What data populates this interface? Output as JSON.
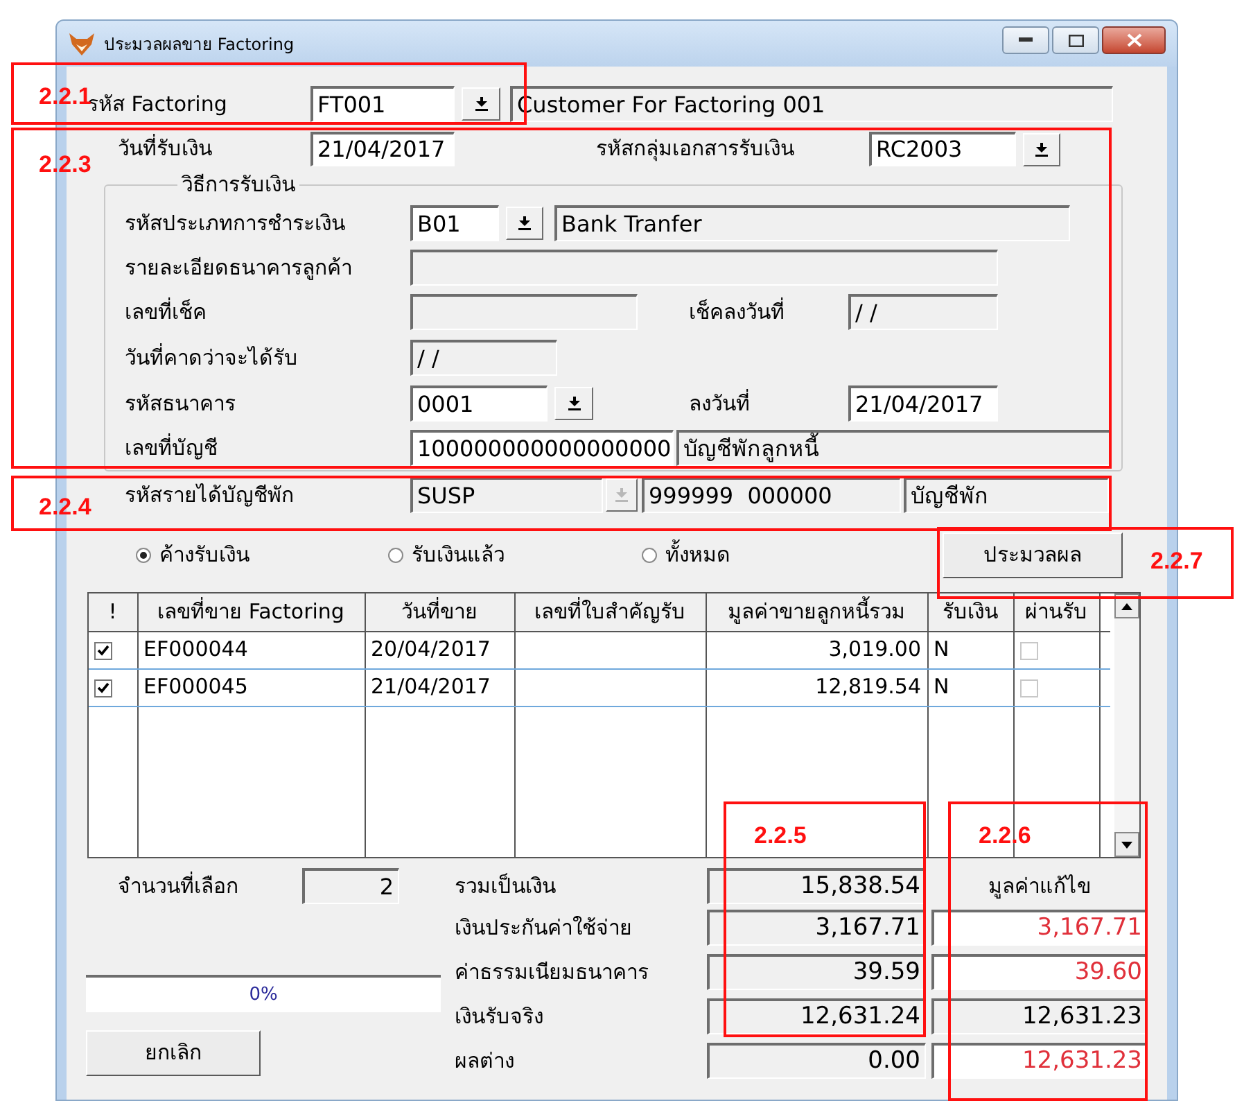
{
  "window": {
    "title": "ประมวลผลขาย Factoring"
  },
  "header_rows": [
    {
      "items": [
        {
          "kind": "label",
          "text": "รหัส Factoring"
        },
        {
          "kind": "field",
          "value": "FT001",
          "editable": true
        },
        {
          "kind": "dropdown",
          "disabled": false
        },
        {
          "kind": "field",
          "value": "Customer For Factoring 001",
          "editable": false
        }
      ]
    },
    {
      "items": [
        {
          "kind": "label",
          "text": "วันที่รับเงิน"
        },
        {
          "kind": "field",
          "value": "21/04/2017",
          "editable": true
        },
        {
          "kind": "label",
          "text": "รหัสกลุ่มเอกสารรับเงิน"
        },
        {
          "kind": "field",
          "value": "RC2003",
          "editable": true
        },
        {
          "kind": "dropdown",
          "disabled": false
        }
      ]
    }
  ],
  "payment_group": {
    "title": "วิธีการรับเงิน",
    "rows": [
      {
        "items": [
          {
            "kind": "label",
            "text": "รหัสประเภทการชำระเงิน"
          },
          {
            "kind": "field",
            "value": "B01",
            "editable": true
          },
          {
            "kind": "dropdown",
            "disabled": false
          },
          {
            "kind": "field",
            "value": "Bank Tranfer",
            "editable": false
          }
        ]
      },
      {
        "items": [
          {
            "kind": "label",
            "text": "รายละเอียดธนาคารลูกค้า"
          },
          {
            "kind": "field",
            "editable": false
          }
        ]
      },
      {
        "items": [
          {
            "kind": "label",
            "text": "เลขที่เช็ค"
          },
          {
            "kind": "field",
            "editable": false
          },
          {
            "kind": "label",
            "text": "เช็คลงวันที่"
          },
          {
            "kind": "field",
            "value": "/ /",
            "editable": false
          }
        ]
      },
      {
        "items": [
          {
            "kind": "label",
            "text": "วันที่คาดว่าจะได้รับ"
          },
          {
            "kind": "field",
            "value": "/ /",
            "editable": false
          }
        ]
      },
      {
        "items": [
          {
            "kind": "label",
            "text": "รหัสธนาคาร"
          },
          {
            "kind": "field",
            "value": "0001",
            "editable": true
          },
          {
            "kind": "dropdown",
            "disabled": false
          },
          {
            "kind": "label",
            "text": "ลงวันที่"
          },
          {
            "kind": "field",
            "value": "21/04/2017",
            "editable": true
          }
        ]
      },
      {
        "items": [
          {
            "kind": "label",
            "text": "เลขที่บัญชี"
          },
          {
            "kind": "field",
            "value": "100000000000000000",
            "editable": true
          },
          {
            "kind": "field",
            "value": "บัญชีพักลูกหนี้",
            "editable": false
          }
        ]
      }
    ]
  },
  "suspense_row": {
    "items": [
      {
        "kind": "label",
        "text": "รหัสรายได้บัญชีพัก"
      },
      {
        "kind": "field",
        "value": "SUSP",
        "editable": false
      },
      {
        "kind": "dropdown",
        "disabled": true
      },
      {
        "kind": "field",
        "value": "999999  000000",
        "editable": false
      },
      {
        "kind": "field",
        "value": "บัญชีพัก",
        "editable": false
      }
    ]
  },
  "filter": {
    "options": [
      {
        "label": "ค้างรับเงิน",
        "selected": true
      },
      {
        "label": "รับเงินแล้ว",
        "selected": false
      },
      {
        "label": "ทั้งหมด",
        "selected": false
      }
    ]
  },
  "process_button": "ประมวลผล",
  "table": {
    "columns": [
      "!",
      "เลขที่ขาย Factoring",
      "วันที่ขาย",
      "เลขที่ใบสำคัญรับ",
      "มูลค่าขายลูกหนี้รวม",
      "รับเงิน",
      "ผ่านรับ"
    ],
    "rows": [
      {
        "checked": true,
        "number": "EF000044",
        "date": "20/04/2017",
        "amount": "3,019.00",
        "received": "N",
        "passed": false
      },
      {
        "checked": true,
        "number": "EF000045",
        "date": "21/04/2017",
        "amount": "12,819.54",
        "received": "N",
        "passed": false
      }
    ]
  },
  "summary": {
    "selected_count": {
      "label": "จำนวนที่เลือก",
      "value": "2"
    },
    "revised_header": "มูลค่าแก้ไข",
    "rows": [
      {
        "label": "รวมเป็นเงิน",
        "value": "15,838.54"
      },
      {
        "label": "เงินประกันค่าใช้จ่าย",
        "value": "3,167.71",
        "revised": {
          "value": "3,167.71",
          "changed": true
        }
      },
      {
        "label": "ค่าธรรมเนียมธนาคาร",
        "value": "39.59",
        "revised": {
          "value": "39.60",
          "changed": true
        }
      },
      {
        "label": "เงินรับจริง",
        "value": "12,631.24",
        "revised": {
          "value": "12,631.23",
          "changed": false
        }
      },
      {
        "label": "ผลต่าง",
        "value": "0.00",
        "revised": {
          "value": "12,631.23",
          "changed": true
        }
      }
    ]
  },
  "progress": {
    "text": "0%",
    "level": 0
  },
  "cancel_button": "ยกเลิก",
  "annotations": [
    {
      "label": "2.2.1"
    },
    {
      "label": "2.2.3"
    },
    {
      "label": "2.2.4"
    },
    {
      "label": "2.2.7"
    },
    {
      "label": "2.2.5"
    },
    {
      "label": "2.2.6"
    }
  ]
}
